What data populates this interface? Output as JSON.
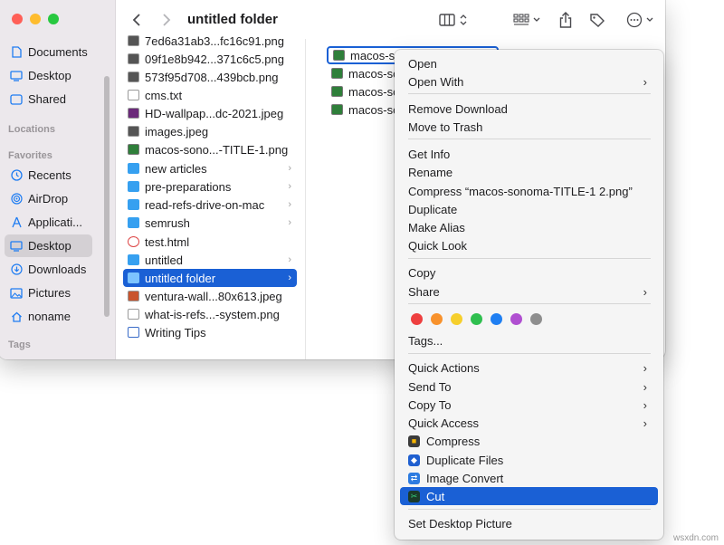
{
  "window": {
    "title": "untitled folder"
  },
  "sidebar": {
    "items": [
      {
        "label": "Documents",
        "icon": "document-icon"
      },
      {
        "label": "Desktop",
        "icon": "desktop-icon"
      },
      {
        "label": "Shared",
        "icon": "shared-icon"
      }
    ],
    "locations_header": "Locations",
    "favorites_header": "Favorites",
    "favorites": [
      {
        "label": "Recents",
        "icon": "clock-icon"
      },
      {
        "label": "AirDrop",
        "icon": "airdrop-icon"
      },
      {
        "label": "Applicati...",
        "icon": "applications-icon"
      },
      {
        "label": "Desktop",
        "icon": "desktop-icon"
      },
      {
        "label": "Downloads",
        "icon": "download-icon"
      },
      {
        "label": "Pictures",
        "icon": "pictures-icon"
      },
      {
        "label": "noname",
        "icon": "home-icon"
      }
    ],
    "tags_header": "Tags"
  },
  "column1": {
    "files": [
      {
        "name": "7ed6a31ab3...fc16c91.png",
        "type": "img",
        "folder": false
      },
      {
        "name": "09f1e8b942...371c6c5.png",
        "type": "img",
        "folder": false
      },
      {
        "name": "573f95d708...439bcb.png",
        "type": "img",
        "folder": false
      },
      {
        "name": "cms.txt",
        "type": "doc",
        "folder": false
      },
      {
        "name": "HD-wallpap...dc-2021.jpeg",
        "type": "img",
        "folder": false
      },
      {
        "name": "images.jpeg",
        "type": "img",
        "folder": false
      },
      {
        "name": "macos-sono...-TITLE-1.png",
        "type": "img2",
        "folder": false
      },
      {
        "name": "new articles",
        "type": "folder",
        "folder": true
      },
      {
        "name": "pre-preparations",
        "type": "folder",
        "folder": true
      },
      {
        "name": "read-refs-drive-on-mac",
        "type": "folder",
        "folder": true
      },
      {
        "name": "semrush",
        "type": "folder",
        "folder": true
      },
      {
        "name": "test.html",
        "type": "html",
        "folder": false
      },
      {
        "name": "untitled",
        "type": "folder",
        "folder": true
      },
      {
        "name": "untitled folder",
        "type": "folder",
        "folder": true,
        "selected": true
      },
      {
        "name": "ventura-wall...80x613.jpeg",
        "type": "img",
        "folder": false
      },
      {
        "name": "what-is-refs...-system.png",
        "type": "doc",
        "folder": false
      },
      {
        "name": "Writing Tips",
        "type": "word",
        "folder": false
      }
    ]
  },
  "column2": {
    "files": [
      {
        "name": "macos-so"
      },
      {
        "name": "macos-so"
      },
      {
        "name": "macos-so"
      },
      {
        "name": "macos-so"
      }
    ]
  },
  "context_menu": {
    "items": {
      "open": "Open",
      "open_with": "Open With",
      "move_download": "Remove Download",
      "move_to_trash": "Move to Trash",
      "get_info": "Get Info",
      "rename": "Rename",
      "compress": "Compress “macos-sonoma-TITLE-1 2.png”",
      "duplicate": "Duplicate",
      "make_alias": "Make Alias",
      "quick_look": "Quick Look",
      "copy": "Copy",
      "share": "Share",
      "tags": "Tags...",
      "quick_actions": "Quick Actions",
      "send_to": "Send To",
      "copy_to": "Copy To",
      "quick_access": "Quick Access",
      "compress_svc": "Compress",
      "duplicate_files": "Duplicate Files",
      "image_convert": "Image Convert",
      "cut": "Cut",
      "set_desktop_picture": "Set Desktop Picture"
    },
    "tag_colors": [
      "#ee3f3f",
      "#f8922c",
      "#f6cf2c",
      "#2fbf4f",
      "#1f7ff2",
      "#b04fd1",
      "#8e8e8e"
    ],
    "highlight_color": "#1a60d5"
  },
  "watermark": "wsxdn.com"
}
